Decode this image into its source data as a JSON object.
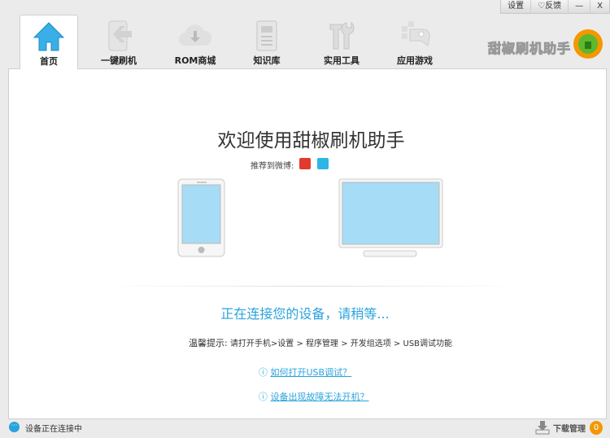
{
  "window": {
    "settings": "设置",
    "feedback": "♡反馈",
    "minimize": "—",
    "close": "X"
  },
  "tabs": [
    {
      "label": "首页"
    },
    {
      "label": "一键刷机"
    },
    {
      "label": "ROM商城"
    },
    {
      "label": "知识库"
    },
    {
      "label": "实用工具"
    },
    {
      "label": "应用游戏"
    }
  ],
  "brand": {
    "name": "甜椒刷机助手"
  },
  "main": {
    "title": "欢迎使用甜椒刷机助手",
    "share_label": "推荐到微博:",
    "status": "正在连接您的设备，请稍等...",
    "hint_label": "温馨提示:",
    "hint": "请打开手机>设置 > 程序管理 > 开发组选项 > USB调试功能",
    "links": [
      {
        "text": "如何打开USB调试？"
      },
      {
        "text": "设备出现故障无法开机？"
      }
    ]
  },
  "statusbar": {
    "text": "设备正在连接中",
    "download": "下载管理",
    "download_count": "0"
  },
  "colors": {
    "accent": "#29a3dc",
    "badge": "#f39800"
  }
}
